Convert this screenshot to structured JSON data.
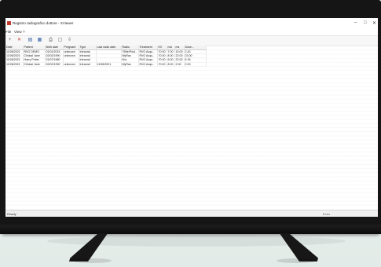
{
  "window": {
    "title": "Registro radiografico dottore - XViewer",
    "minimize": "–",
    "maximize": "□",
    "close": "✕"
  },
  "menu": [
    "File",
    "View",
    "?"
  ],
  "toolbar": {
    "icons": [
      "add-icon",
      "delete-icon",
      "list-icon",
      "grid-icon",
      "print-icon",
      "preview-icon",
      "export-icon"
    ],
    "glyphs": [
      "+",
      "✕",
      "▤",
      "▦",
      "⎙",
      "▢",
      "⇩"
    ]
  },
  "table": {
    "columns": [
      "Date",
      "Patient",
      "Birth date",
      "Pregnant",
      "Type",
      "Last radio date",
      "Radio",
      "Treatment",
      "KV",
      "mA",
      "ms",
      "Dose..."
    ],
    "rows": [
      [
        "11/06/2021",
        "RVG DEMO",
        "01/01/2015",
        "unknown",
        "Intraoral",
        "",
        "7Bite/Post..",
        "RVG Acqu..",
        "70.00",
        "7.00",
        "10.00",
        "2.43"
      ],
      [
        "11/06/2021",
        "Clinical Jane",
        "02/02/1990",
        "unknown",
        "Intraoral",
        "",
        "MyRas",
        "RVG Acqu..",
        "70.00",
        "8.00",
        "22.00",
        "23.00"
      ],
      [
        "11/06/2021",
        "Harry Potter",
        "31/07/1980",
        "",
        "Intraoral",
        "",
        "N/a",
        "RVG Acqu..",
        "70.00",
        "6.00",
        "22.00",
        "5.18"
      ],
      [
        "11/06/2021",
        "Clinical Jane",
        "02/02/1990",
        "unknown",
        "Intraoral",
        "11/06/2021",
        "MyRas",
        "RVG Acqu..",
        "70.00",
        "8.00",
        "2.00",
        "2.00"
      ]
    ]
  },
  "status": {
    "left": "Ready",
    "right": "0 Lin"
  }
}
